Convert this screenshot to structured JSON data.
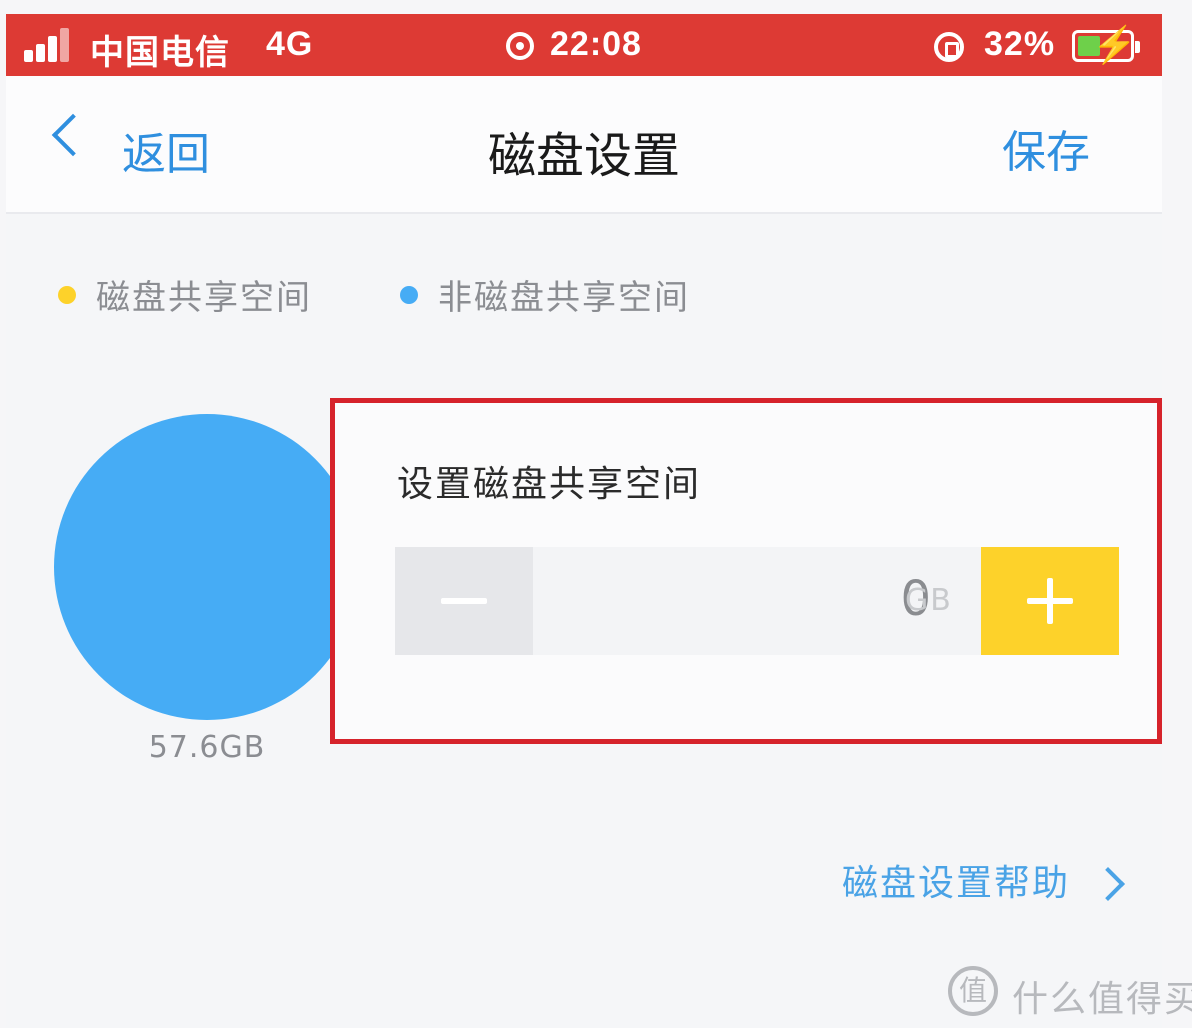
{
  "status_bar": {
    "carrier": "中国电信",
    "network": "4G",
    "time": "22:08",
    "battery": "32%"
  },
  "nav": {
    "back_label": "返回",
    "title": "磁盘设置",
    "save_label": "保存"
  },
  "legend": [
    {
      "label": "磁盘共享空间",
      "color": "#fdd22a"
    },
    {
      "label": "非磁盘共享空间",
      "color": "#46acf5"
    }
  ],
  "disk": {
    "total_label": "57.6GB",
    "shared_fraction": 0
  },
  "share_setting": {
    "title": "设置磁盘共享空间",
    "value": "0",
    "unit": "GB"
  },
  "help": {
    "label": "磁盘设置帮助"
  },
  "watermark": {
    "badge": "值",
    "text": "什么值得买"
  },
  "colors": {
    "status_bar": "#dd3a34",
    "accent_blue": "#2f8fdf",
    "pie_blue": "#46acf5",
    "accent_yellow": "#fdd22a",
    "highlight_red": "#d6232b"
  }
}
